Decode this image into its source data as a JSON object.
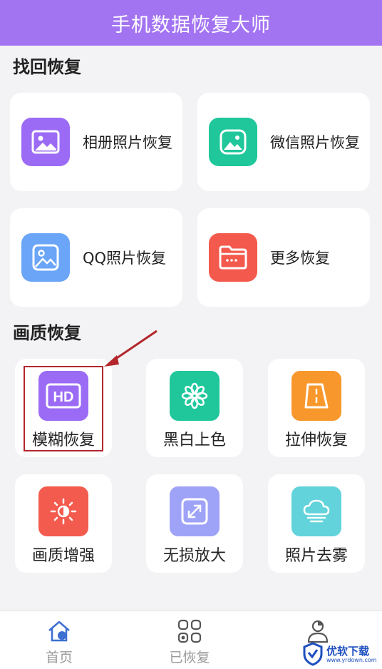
{
  "header": {
    "title": "手机数据恢复大师"
  },
  "sections": {
    "recover_title": "找回恢复",
    "quality_title": "画质恢复"
  },
  "recover_cards": [
    {
      "label": "相册照片恢复",
      "icon": "album-photo-icon",
      "color": "#9b6bf5"
    },
    {
      "label": "微信照片恢复",
      "icon": "wechat-photo-icon",
      "color": "#1fc79b"
    },
    {
      "label": "QQ照片恢复",
      "icon": "qq-photo-icon",
      "color": "#6aa5f7"
    },
    {
      "label": "更多恢复",
      "icon": "folder-icon",
      "color": "#f3594c"
    }
  ],
  "quality_cards": [
    {
      "label": "模糊恢复",
      "icon": "hd-icon",
      "color": "#9b6bf5"
    },
    {
      "label": "黑白上色",
      "icon": "flower-icon",
      "color": "#1fc79b"
    },
    {
      "label": "拉伸恢复",
      "icon": "stretch-icon",
      "color": "#f8982c"
    },
    {
      "label": "画质增强",
      "icon": "brightness-icon",
      "color": "#f35b4e"
    },
    {
      "label": "无损放大",
      "icon": "expand-icon",
      "color": "#9fa3f7"
    },
    {
      "label": "照片去雾",
      "icon": "cloud-icon",
      "color": "#62d3db"
    }
  ],
  "bottom_nav": [
    {
      "label": "首页",
      "icon": "home-icon"
    },
    {
      "label": "已恢复",
      "icon": "grid-icon"
    },
    {
      "label": "",
      "icon": "user-icon"
    }
  ],
  "watermark": {
    "text": "优软下载",
    "sub": "www.yrdown.com"
  }
}
